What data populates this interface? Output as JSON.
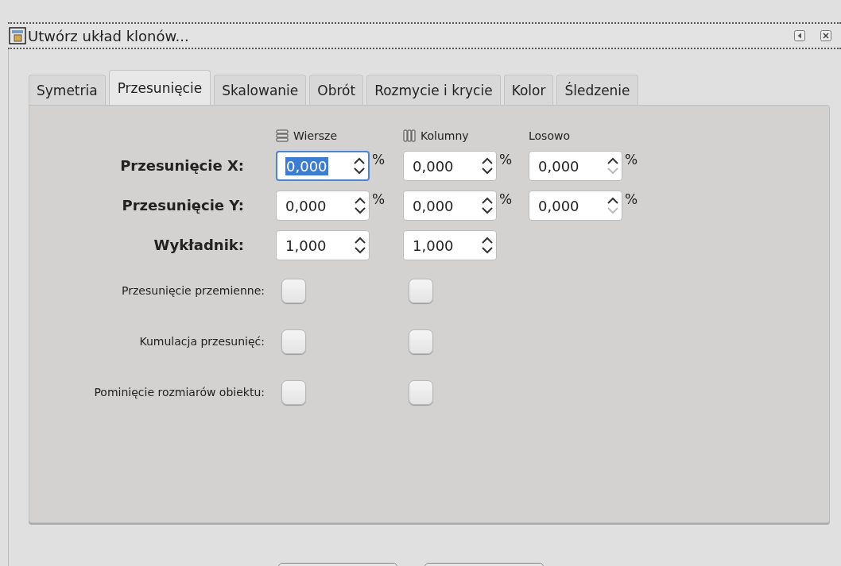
{
  "window": {
    "title": "Utwórz układ klonów..."
  },
  "tabs": [
    {
      "label": "Symetria",
      "selected": false
    },
    {
      "label": "Przesunięcie",
      "selected": true
    },
    {
      "label": "Skalowanie",
      "selected": false
    },
    {
      "label": "Obrót",
      "selected": false
    },
    {
      "label": "Rozmycie i krycie",
      "selected": false
    },
    {
      "label": "Kolor",
      "selected": false
    },
    {
      "label": "Śledzenie",
      "selected": false
    }
  ],
  "columns": [
    {
      "label": "Wiersze",
      "kind": "rows"
    },
    {
      "label": "Kolumny",
      "kind": "columns"
    },
    {
      "label": "Losowo",
      "kind": "plain"
    }
  ],
  "spin_rows": [
    {
      "label": "Przesunięcie X:",
      "fields": [
        {
          "value": "0,000",
          "unit": "%",
          "text_selected": true,
          "down_disabled": false
        },
        {
          "value": "0,000",
          "unit": "%",
          "text_selected": false,
          "down_disabled": false
        },
        {
          "value": "0,000",
          "unit": "%",
          "text_selected": false,
          "down_disabled": true
        }
      ]
    },
    {
      "label": "Przesunięcie Y:",
      "fields": [
        {
          "value": "0,000",
          "unit": "%",
          "text_selected": false,
          "down_disabled": false
        },
        {
          "value": "0,000",
          "unit": "%",
          "text_selected": false,
          "down_disabled": false
        },
        {
          "value": "0,000",
          "unit": "%",
          "text_selected": false,
          "down_disabled": true
        }
      ]
    },
    {
      "label": "Wykładnik:",
      "fields": [
        {
          "value": "1,000",
          "text_selected": false,
          "down_disabled": false
        },
        {
          "value": "1,000",
          "text_selected": false,
          "down_disabled": false
        }
      ]
    }
  ],
  "check_rows": [
    {
      "label": "Przesunięcie przemienne:",
      "checks": [
        {
          "checked": false
        },
        {
          "checked": false
        }
      ]
    },
    {
      "label": "Kumulacja przesunięć:",
      "checks": [
        {
          "checked": false
        },
        {
          "checked": false
        }
      ]
    },
    {
      "label": "Pominięcie rozmiarów obiektu:",
      "checks": [
        {
          "checked": false
        },
        {
          "checked": false
        }
      ]
    }
  ]
}
